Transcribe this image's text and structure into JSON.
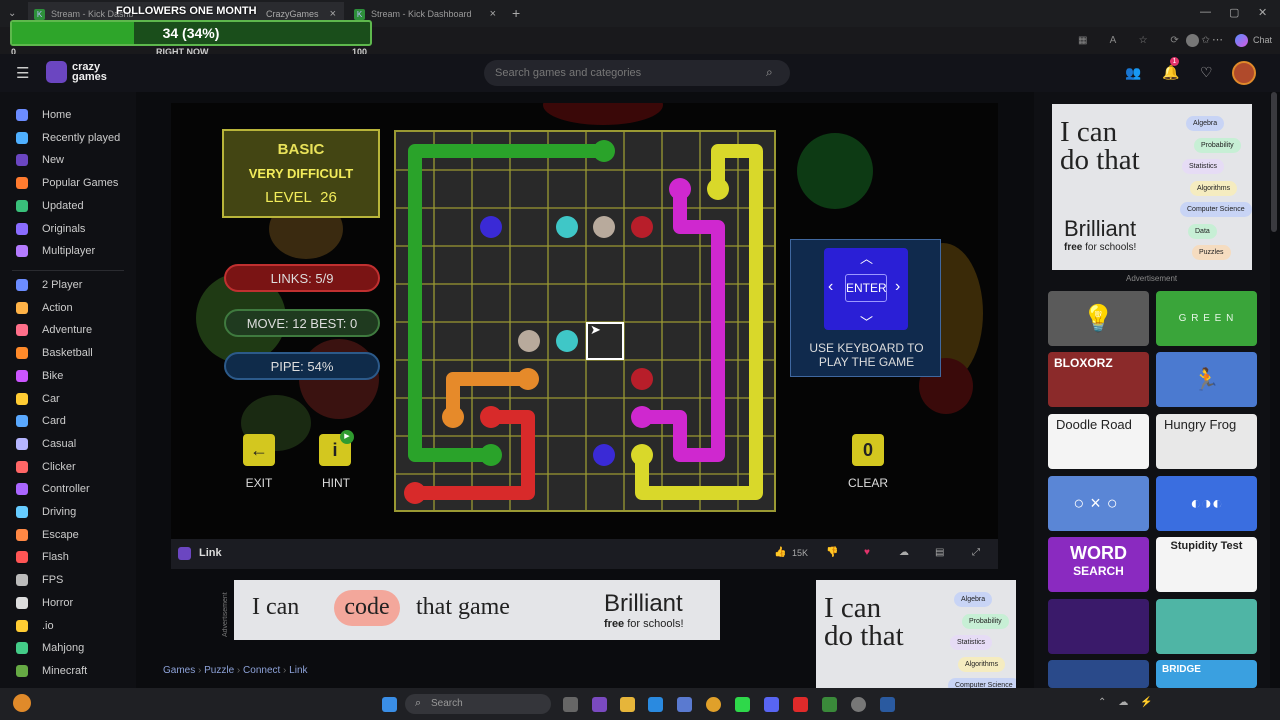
{
  "browser": {
    "tabs": [
      {
        "label": "Stream - Kick Dashb"
      },
      {
        "label": "CrazyGames"
      },
      {
        "label": "Stream - Kick Dashboard"
      }
    ],
    "chat_label": "Chat"
  },
  "overlay": {
    "title": "FOLLOWERS ONE MONTH",
    "progress_text": "34 (34%)",
    "progress_value": 34,
    "progress_max": 100,
    "min_label": "0",
    "now_label": "RIGHT NOW",
    "max_label": "100"
  },
  "site": {
    "logo_line1": "crazy",
    "logo_line2": "games",
    "search_placeholder": "Search games and categories",
    "notification_count": "1"
  },
  "sidebar": {
    "main": [
      {
        "label": "Home",
        "icon": "home-icon",
        "color": "#6b8cff"
      },
      {
        "label": "Recently played",
        "icon": "clock-icon",
        "color": "#4fb0ff"
      },
      {
        "label": "New",
        "icon": "star-icon",
        "color": "#6b46c1"
      },
      {
        "label": "Popular Games",
        "icon": "fire-icon",
        "color": "#ff7b2f"
      },
      {
        "label": "Updated",
        "icon": "refresh-icon",
        "color": "#39c07a"
      },
      {
        "label": "Originals",
        "icon": "originals-icon",
        "color": "#8a6cff"
      },
      {
        "label": "Multiplayer",
        "icon": "people-icon",
        "color": "#b47bff"
      }
    ],
    "categories": [
      {
        "label": "2 Player",
        "icon": "two-player-icon",
        "color": "#6b8cff"
      },
      {
        "label": "Action",
        "icon": "sword-icon",
        "color": "#ffb347"
      },
      {
        "label": "Adventure",
        "icon": "compass-icon",
        "color": "#ff6f8a"
      },
      {
        "label": "Basketball",
        "icon": "basketball-icon",
        "color": "#ff8a2a"
      },
      {
        "label": "Bike",
        "icon": "bike-icon",
        "color": "#cc55ff"
      },
      {
        "label": "Car",
        "icon": "car-icon",
        "color": "#ffcc33"
      },
      {
        "label": "Card",
        "icon": "card-icon",
        "color": "#5aa9ff"
      },
      {
        "label": "Casual",
        "icon": "casual-icon",
        "color": "#b5b5ff"
      },
      {
        "label": "Clicker",
        "icon": "cursor-icon",
        "color": "#ff6666"
      },
      {
        "label": "Controller",
        "icon": "controller-icon",
        "color": "#aa66ff"
      },
      {
        "label": "Driving",
        "icon": "wheel-icon",
        "color": "#66ccff"
      },
      {
        "label": "Escape",
        "icon": "door-icon",
        "color": "#ff8844"
      },
      {
        "label": "Flash",
        "icon": "flash-icon",
        "color": "#ff5555"
      },
      {
        "label": "FPS",
        "icon": "gun-icon",
        "color": "#bbbbbb"
      },
      {
        "label": "Horror",
        "icon": "ghost-icon",
        "color": "#dddddd"
      },
      {
        "label": ".io",
        "icon": "io-icon",
        "color": "#ffcc33"
      },
      {
        "label": "Mahjong",
        "icon": "mahjong-icon",
        "color": "#44cc88"
      },
      {
        "label": "Minecraft",
        "icon": "block-icon",
        "color": "#66aa44"
      }
    ]
  },
  "game": {
    "mode": "BASIC",
    "difficulty": "VERY DIFFICULT",
    "level_label": "LEVEL",
    "level_value": "26",
    "links": "LINKS:   5/9",
    "moves": "MOVE: 12   BEST: 0",
    "pipe": "PIPE:   54%",
    "exit_label": "EXIT",
    "hint_label": "HINT",
    "clear_label": "CLEAR",
    "clear_count": "0",
    "enter_label": "ENTER",
    "keyboard_hint_1": "USE KEYBOARD TO",
    "keyboard_hint_2": "PLAY THE GAME"
  },
  "game_bar": {
    "title": "Link",
    "likes": "15K"
  },
  "breadcrumb": [
    "Games",
    "Puzzle",
    "Connect",
    "Link"
  ],
  "ads": {
    "big_text_1": "I can",
    "big_text_2": "do that",
    "brand": "Brilliant",
    "free_schools": "free for schools!",
    "free_word": "free",
    "for_schools": "for schools!",
    "advertisement": "Advertisement",
    "banner_pre": "I can",
    "banner_code": "code",
    "banner_post": "that game",
    "topics": [
      "Algebra",
      "Probability",
      "Statistics",
      "Algorithms",
      "Computer Science",
      "Data",
      "Puzzles"
    ],
    "topics_small": [
      "Algebra",
      "Probability",
      "Statistics",
      "Algorithms",
      "Computer Science"
    ]
  },
  "thumbnails": {
    "green": "G R E E N",
    "bloxorz": "BLOXORZ",
    "doodle": "Doodle Road",
    "frog": "Hungry Frog",
    "word1": "WORD",
    "word2": "SEARCH",
    "stupidity": "Stupidity Test",
    "bridge": "BRIDGE"
  },
  "taskbar": {
    "search_label": "Search"
  }
}
